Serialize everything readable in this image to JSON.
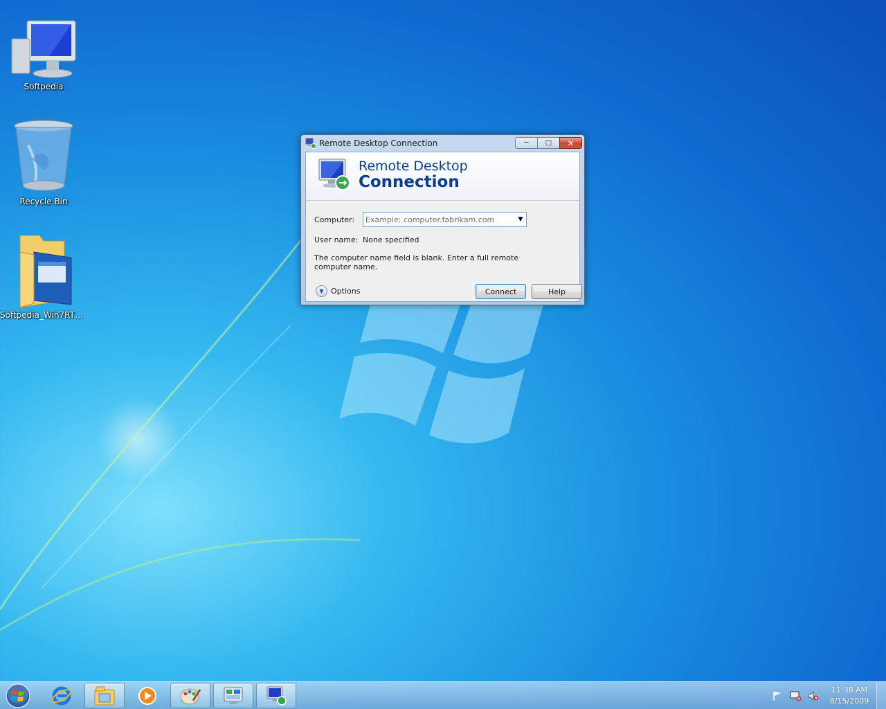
{
  "desktop": {
    "icons": [
      {
        "label": "Softpedia",
        "icon": "computer-icon"
      },
      {
        "label": "Recycle Bin",
        "icon": "recycle-bin-icon"
      },
      {
        "label": "Softpedia_Win7RTMS...",
        "icon": "folder-icon"
      }
    ]
  },
  "dialog": {
    "title": "Remote Desktop Connection",
    "banner_line1": "Remote Desktop",
    "banner_line2": "Connection",
    "computer_label": "Computer:",
    "computer_placeholder": "Example: computer.fabrikam.com",
    "computer_value": "",
    "username_label": "User name:",
    "username_value": "None specified",
    "message": "The computer name field is blank. Enter a full remote computer name.",
    "options_label": "Options",
    "connect_label": "Connect",
    "help_label": "Help",
    "caption_buttons": {
      "minimize": "minimize-icon",
      "maximize": "maximize-icon",
      "close": "close-icon"
    }
  },
  "taskbar": {
    "items": [
      {
        "name": "internet-explorer",
        "icon": "ie-icon",
        "state": "pinned"
      },
      {
        "name": "windows-explorer",
        "icon": "explorer-icon",
        "state": "pinned"
      },
      {
        "name": "media-player",
        "icon": "media-player-icon",
        "state": "pinned"
      },
      {
        "name": "paint",
        "icon": "paint-icon",
        "state": "pinned"
      },
      {
        "name": "control-panel",
        "icon": "control-panel-icon",
        "state": "pinned"
      },
      {
        "name": "remote-desktop",
        "icon": "remote-desktop-icon",
        "state": "running"
      }
    ],
    "tray_icons": [
      "action-center-flag-icon",
      "network-icon",
      "volume-muted-icon"
    ],
    "time": "11:38 AM",
    "date": "8/15/2009"
  },
  "colors": {
    "desktop_accent": "#1a8fe0",
    "banner_text": "#0a3d8f",
    "close_button": "#c8452f"
  }
}
